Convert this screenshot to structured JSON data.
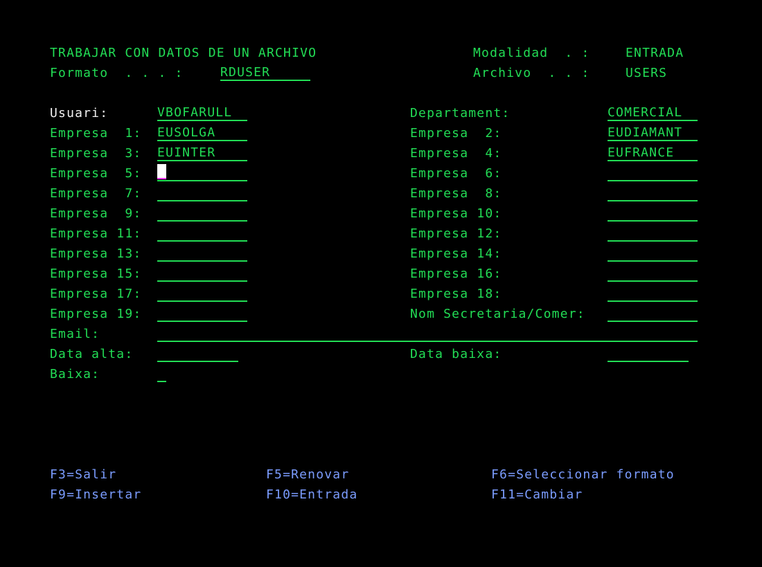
{
  "header": {
    "title": "TRABAJAR CON DATOS DE UN ARCHIVO",
    "format_label": "Formato  . . . :",
    "format_value": "RDUSER",
    "mode_label": "Modalidad  . :",
    "mode_value": "ENTRADA",
    "file_label": "Archivo  . . :",
    "file_value": "USERS"
  },
  "form": {
    "user_label": "Usuari:",
    "user_value": "VBOFARULL",
    "department_label": "Departament:",
    "department_value": "COMERCIAL",
    "empresa_left": [
      {
        "label": "Empresa  1:",
        "value": "EUSOLGA"
      },
      {
        "label": "Empresa  3:",
        "value": "EUINTER"
      },
      {
        "label": "Empresa  5:",
        "value": ""
      },
      {
        "label": "Empresa  7:",
        "value": ""
      },
      {
        "label": "Empresa  9:",
        "value": ""
      },
      {
        "label": "Empresa 11:",
        "value": ""
      },
      {
        "label": "Empresa 13:",
        "value": ""
      },
      {
        "label": "Empresa 15:",
        "value": ""
      },
      {
        "label": "Empresa 17:",
        "value": ""
      },
      {
        "label": "Empresa 19:",
        "value": ""
      }
    ],
    "empresa_right": [
      {
        "label": "Empresa  2:",
        "value": "EUDIAMANT"
      },
      {
        "label": "Empresa  4:",
        "value": "EUFRANCE"
      },
      {
        "label": "Empresa  6:",
        "value": ""
      },
      {
        "label": "Empresa  8:",
        "value": ""
      },
      {
        "label": "Empresa 10:",
        "value": ""
      },
      {
        "label": "Empresa 12:",
        "value": ""
      },
      {
        "label": "Empresa 14:",
        "value": ""
      },
      {
        "label": "Empresa 16:",
        "value": ""
      },
      {
        "label": "Empresa 18:",
        "value": ""
      }
    ],
    "secretaria_label": "Nom Secretaria/Comer:",
    "secretaria_value": "",
    "email_label": "Email:",
    "email_value": "",
    "data_alta_label": "Data alta:",
    "data_alta_value": "",
    "data_baixa_label": "Data baixa:",
    "data_baixa_value": "",
    "baixa_label": "Baixa:",
    "baixa_value": ""
  },
  "function_keys": [
    "F3=Salir",
    "F5=Renovar",
    "F6=Seleccionar formato",
    "F9=Insertar",
    "F10=Entrada",
    "F11=Cambiar"
  ],
  "colors": {
    "background": "#000000",
    "field_green": "#22dd55",
    "label_white": "#f0f0f0",
    "function_key_blue": "#7b9cff",
    "cursor_underline": "#ff33ff"
  }
}
